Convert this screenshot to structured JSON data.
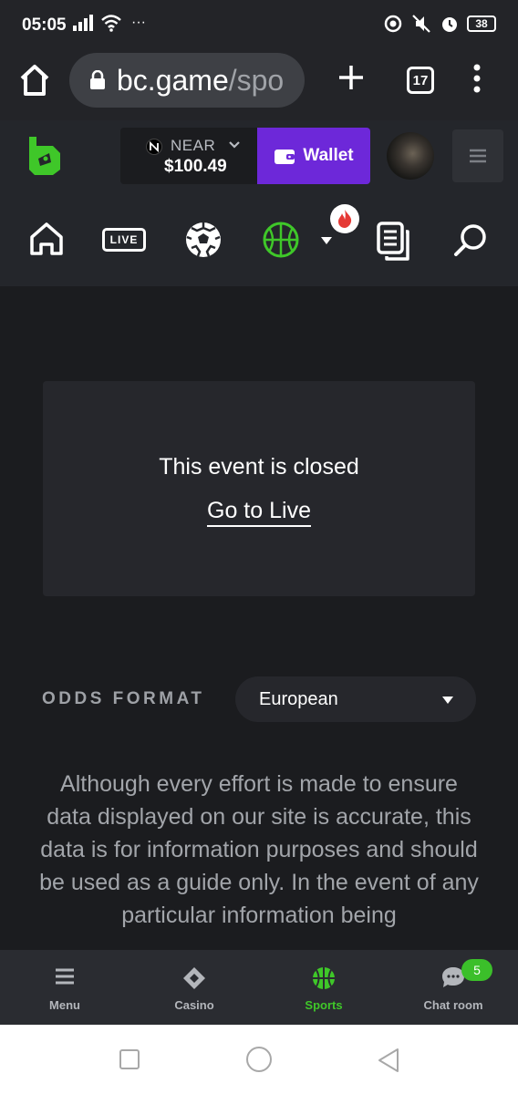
{
  "status_bar": {
    "time": "05:05",
    "more": "···",
    "battery": "38"
  },
  "browser": {
    "url_host": "bc.game",
    "url_path": "/spo",
    "tab_count": "17"
  },
  "header": {
    "currency": "NEAR",
    "amount": "$100.49",
    "wallet_label": "Wallet"
  },
  "sports_nav": {
    "live_label": "LIVE"
  },
  "event": {
    "closed_text": "This event is closed",
    "go_live_link": "Go to Live"
  },
  "odds": {
    "label": "ODDS FORMAT",
    "selected": "European"
  },
  "disclaimer": "Although every effort is made to ensure data displayed on our site is accurate, this data is for information purposes and should be used as a guide only. In the event of any particular information being",
  "bottom_nav": {
    "menu": "Menu",
    "casino": "Casino",
    "sports": "Sports",
    "chat": "Chat room",
    "chat_badge": "5"
  },
  "colors": {
    "accent_green": "#3fc729",
    "wallet_purple": "#6d28d9",
    "background": "#1b1c1f"
  }
}
